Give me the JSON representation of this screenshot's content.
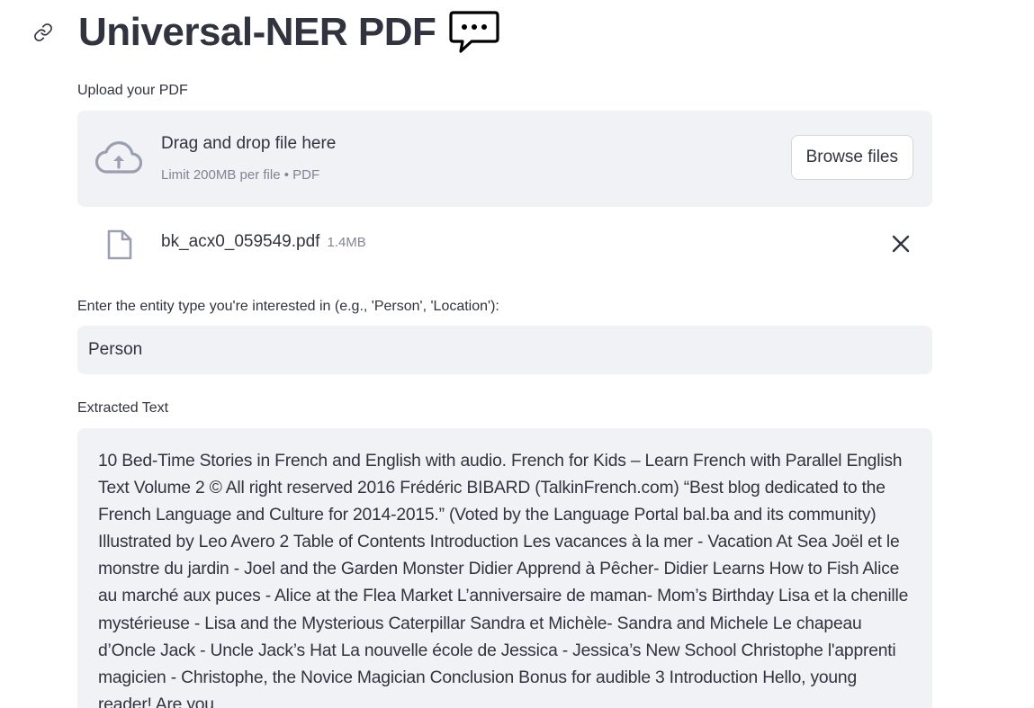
{
  "header": {
    "title": "Universal-NER PDF",
    "link_icon": "link-icon",
    "title_icon": "speech-bubble-icon"
  },
  "uploader": {
    "label": "Upload your PDF",
    "drop_title": "Drag and drop file here",
    "drop_subtitle": "Limit 200MB per file • PDF",
    "browse_label": "Browse files",
    "icon": "cloud-upload-icon"
  },
  "uploaded_file": {
    "name": "bk_acx0_059549.pdf",
    "size": "1.4MB",
    "icon": "file-icon",
    "remove_icon": "close-icon"
  },
  "entity_input": {
    "label": "Enter the entity type you're interested in (e.g., 'Person', 'Location'):",
    "value": "Person"
  },
  "extracted": {
    "label": "Extracted Text",
    "text": "10 Bed-Time Stories in French  and English with audio.  French for Kids – Learn French with Parallel English  Text Volume 2  © All right reserved 2016    Frédéric BIBARD (TalkinFrench.com)    “Best blog dedicated to the French Language and Culture for 2014-2015.”  (Voted by the Language Portal bal.ba and its community)    Illustrated by Leo Avero 2     Table of Contents  Introduction   Les vacances à la mer - Vacation At Sea  Joël et le monstre du jardin - Joel and the Garden Monster  Didier Apprend à Pêcher- Didier Learns How to Fish    Alice au marché aux puces - Alice at the Flea Market  L’anniversaire de maman- Mom’s Birthday  Lisa et la chenille mystérieuse - Lisa and the Mysterious Caterpillar  Sandra et Michèle- Sandra and Michele    Le chapeau d’Oncle Jack - Uncle Jack’s Hat  La nouvelle école de Jessica - Jessica’s New School    Christophe l'apprenti magicien - Christophe, the Novice Magician  Conclusion   Bonus for audible 3  Introduction    Hello, young reader!    Are you"
  },
  "colors": {
    "text": "#31333f",
    "muted": "#808495",
    "widget_bg": "#f0f2f6",
    "border": "#d6d6d9"
  }
}
